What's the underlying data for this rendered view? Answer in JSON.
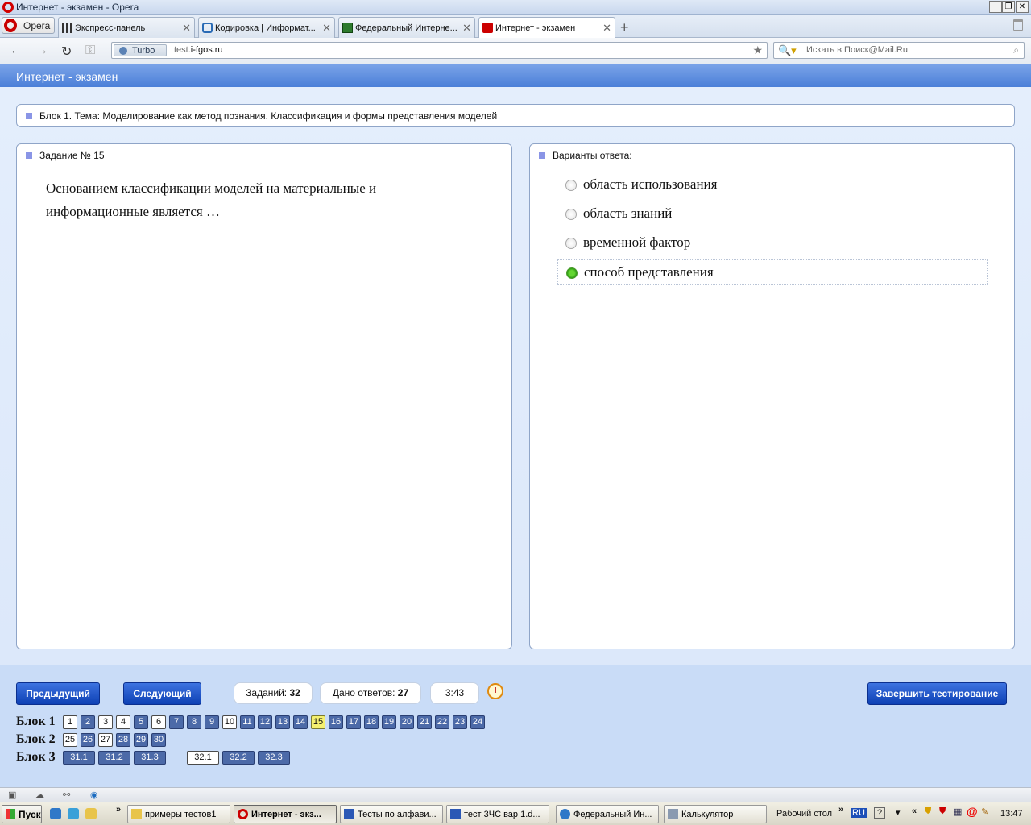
{
  "window": {
    "title": "Интернет - экзамен - Opera",
    "controls": [
      "_",
      "❐",
      "✕"
    ]
  },
  "tabs": {
    "menu_label": "Opera",
    "items": [
      {
        "label": "Экспресс-панель"
      },
      {
        "label": "Кодировка | Информат..."
      },
      {
        "label": "Федеральный Интерне..."
      },
      {
        "label": "Интернет - экзамен"
      }
    ]
  },
  "addressbar": {
    "turbo_label": "Turbo",
    "url_prefix": "test.",
    "url_domain": "i-fgos.ru",
    "search_placeholder": "Искать в Поиск@Mail.Ru"
  },
  "page": {
    "header_title": "Интернет - экзамен",
    "block_title": "Блок 1. Тема: Моделирование как метод познания. Классификация и формы представления моделей",
    "question_title": "Задание № 15",
    "question_text": "Основанием классификации моделей на материальные и информационные является …",
    "answers_title": "Варианты ответа:",
    "answers": [
      {
        "label": "область использования",
        "selected": false
      },
      {
        "label": "область знаний",
        "selected": false
      },
      {
        "label": "временной фактор",
        "selected": false
      },
      {
        "label": "способ представления",
        "selected": true
      }
    ]
  },
  "controls": {
    "prev_label": "Предыдущий",
    "next_label": "Следующий",
    "tasks_label": "Заданий:",
    "tasks_value": "32",
    "answered_label": "Дано ответов:",
    "answered_value": "27",
    "timer": "3:43",
    "finish_label": "Завершить тестирование"
  },
  "blocks": [
    {
      "label": "Блок 1",
      "items": [
        {
          "n": "1",
          "state": "white"
        },
        {
          "n": "2",
          "state": "blue"
        },
        {
          "n": "3",
          "state": "white"
        },
        {
          "n": "4",
          "state": "white"
        },
        {
          "n": "5",
          "state": "blue"
        },
        {
          "n": "6",
          "state": "white"
        },
        {
          "n": "7",
          "state": "blue"
        },
        {
          "n": "8",
          "state": "blue"
        },
        {
          "n": "9",
          "state": "blue"
        },
        {
          "n": "10",
          "state": "white"
        },
        {
          "n": "11",
          "state": "blue"
        },
        {
          "n": "12",
          "state": "blue"
        },
        {
          "n": "13",
          "state": "blue"
        },
        {
          "n": "14",
          "state": "blue"
        },
        {
          "n": "15",
          "state": "current"
        },
        {
          "n": "16",
          "state": "blue"
        },
        {
          "n": "17",
          "state": "blue"
        },
        {
          "n": "18",
          "state": "blue"
        },
        {
          "n": "19",
          "state": "blue"
        },
        {
          "n": "20",
          "state": "blue"
        },
        {
          "n": "21",
          "state": "blue"
        },
        {
          "n": "22",
          "state": "blue"
        },
        {
          "n": "23",
          "state": "blue"
        },
        {
          "n": "24",
          "state": "blue"
        }
      ]
    },
    {
      "label": "Блок 2",
      "items": [
        {
          "n": "25",
          "state": "white"
        },
        {
          "n": "26",
          "state": "blue"
        },
        {
          "n": "27",
          "state": "white"
        },
        {
          "n": "28",
          "state": "blue"
        },
        {
          "n": "29",
          "state": "blue"
        },
        {
          "n": "30",
          "state": "blue"
        }
      ]
    },
    {
      "label": "Блок 3",
      "items": [
        {
          "n": "31.1",
          "state": "blue"
        },
        {
          "n": "31.2",
          "state": "blue"
        },
        {
          "n": "31.3",
          "state": "blue"
        },
        {
          "n": "32.1",
          "state": "white"
        },
        {
          "n": "32.2",
          "state": "blue"
        },
        {
          "n": "32.3",
          "state": "blue"
        }
      ]
    }
  ],
  "taskbar": {
    "start_label": "Пуск",
    "tasks": [
      {
        "label": "примеры тестов1",
        "active": false
      },
      {
        "label": "Интернет - экз...",
        "active": true
      },
      {
        "label": "Тесты по алфави...",
        "active": false
      },
      {
        "label": "тест 3ЧС вар 1.d...",
        "active": false
      },
      {
        "label": "Федеральный Ин...",
        "active": false
      },
      {
        "label": "Калькулятор",
        "active": false
      }
    ],
    "desktop_label": "Рабочий стол",
    "lang": "RU",
    "clock": "13:47"
  }
}
